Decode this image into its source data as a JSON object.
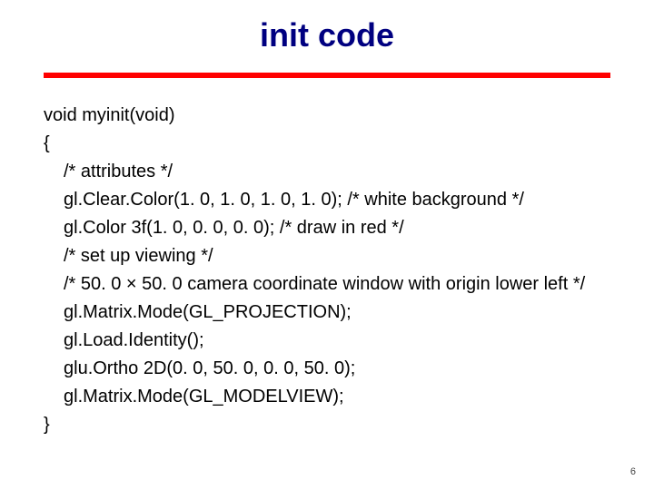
{
  "title": "init code",
  "code": {
    "l0": "void myinit(void)",
    "l1": "{",
    "l2": "/* attributes */",
    "l3": "gl.Clear.Color(1. 0, 1. 0, 1. 0, 1. 0); /* white background */",
    "l4": "gl.Color 3f(1. 0, 0. 0, 0. 0); /* draw in red */",
    "l5": "/* set up viewing */",
    "l6": "/* 50. 0 × 50. 0 camera coordinate window with origin lower left */",
    "l7": "gl.Matrix.Mode(GL_PROJECTION);",
    "l8": "gl.Load.Identity();",
    "l9": "glu.Ortho 2D(0. 0, 50. 0, 0. 0, 50. 0);",
    "l10": "gl.Matrix.Mode(GL_MODELVIEW);",
    "l11": "}"
  },
  "page_number": "6"
}
